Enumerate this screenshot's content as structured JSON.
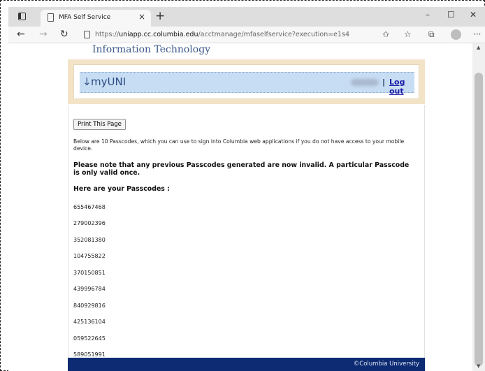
{
  "browser": {
    "tab_title": "MFA Self Service",
    "url_prefix": "https://",
    "url_host": "uniapp.cc.columbia.edu",
    "url_path": "/acctmanage/mfaselfservice?execution=e1s4"
  },
  "header": {
    "org_title": "Information Technology",
    "brand": "myUNI",
    "separator": "|",
    "logout": "Log out"
  },
  "main": {
    "print_button": "Print This Page",
    "intro": "Below are 10 Passcodes, which you can use to sign into Columbia web applications if you do not have access to your mobile device.",
    "note": "Please note that any previous Passcodes generated are now invalid. A particular Passcode is only valid once.",
    "heading": "Here are your Passcodes :",
    "passcodes": [
      "655467468",
      "279002396",
      "352081380",
      "104755822",
      "370150851",
      "439996784",
      "840929816",
      "425136104",
      "059522645",
      "589051991"
    ]
  },
  "footer": {
    "copyright": "©Columbia University"
  }
}
